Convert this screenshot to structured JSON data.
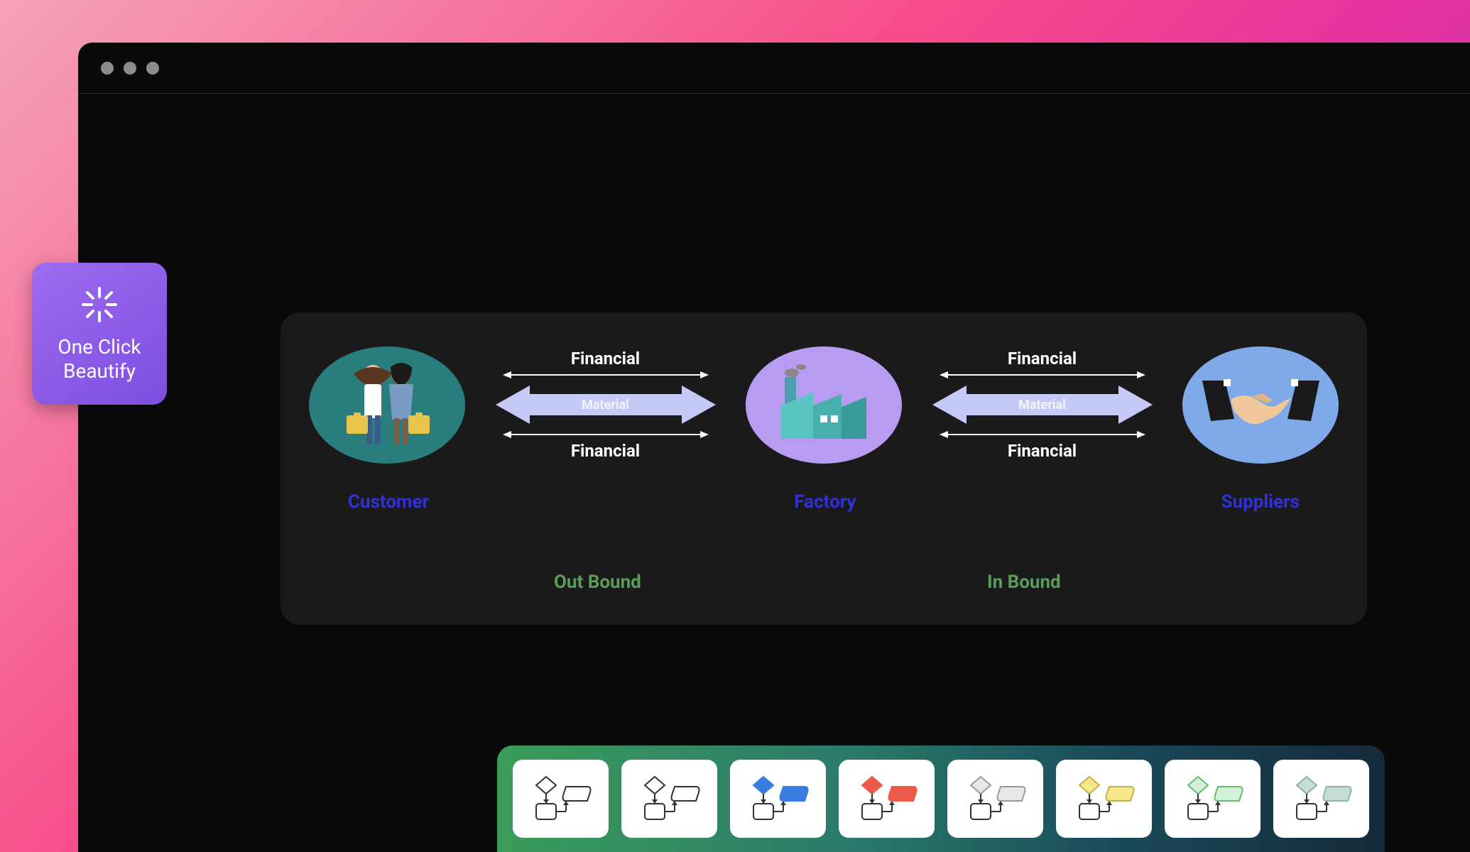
{
  "beautify": {
    "line1": "One Click",
    "line2": "Beautify"
  },
  "diagram": {
    "nodes": {
      "customer": {
        "label": "Customer"
      },
      "factory": {
        "label": "Factory"
      },
      "suppliers": {
        "label": "Suppliers"
      }
    },
    "arrows": {
      "financial_top": "Financial",
      "financial_bottom": "Financial",
      "material": "Material"
    },
    "flows": {
      "out": "Out Bound",
      "in": "In Bound"
    }
  },
  "themes": [
    {
      "fill": "#ffffff",
      "stroke": "#333333"
    },
    {
      "fill": "#ffffff",
      "stroke": "#333333"
    },
    {
      "fill": "#3a7de0",
      "stroke": "#3a7de0"
    },
    {
      "fill": "#ed5a4a",
      "stroke": "#ed5a4a"
    },
    {
      "fill": "#e8e8e8",
      "stroke": "#999999"
    },
    {
      "fill": "#f5e78a",
      "stroke": "#c4b050"
    },
    {
      "fill": "#d5f0d8",
      "stroke": "#6abb70"
    },
    {
      "fill": "#c5ddd5",
      "stroke": "#8ab5aa"
    }
  ]
}
